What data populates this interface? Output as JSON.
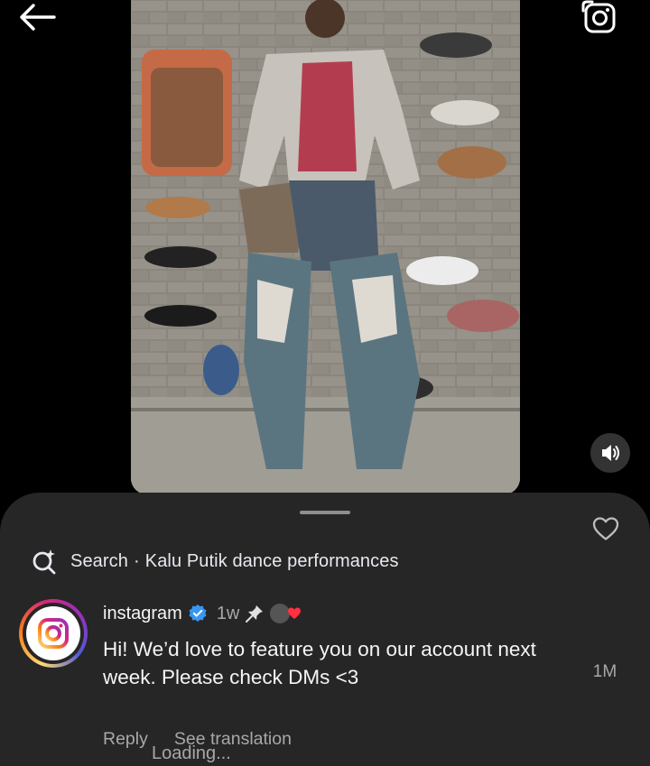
{
  "header": {
    "back_icon": "arrow-left-icon",
    "camera_icon": "camera-icon"
  },
  "video": {
    "volume_icon": "volume-icon"
  },
  "comments_sheet": {
    "search": {
      "label": "Search",
      "separator": "·",
      "query": "Kalu Putik dance performances"
    },
    "comment": {
      "username": "instagram",
      "verified": true,
      "time": "1w",
      "pinned": true,
      "text": "Hi! We’d love to feature you on our account next week. Please check DMs <3",
      "reply_label": "Reply",
      "translate_label": "See translation",
      "likes": "1M"
    },
    "loading_text": "Loading..."
  },
  "colors": {
    "sheet_bg": "#262626",
    "verified_blue": "#3897f0",
    "like_red": "#ff3040",
    "secondary_text": "#a8a8a8"
  }
}
